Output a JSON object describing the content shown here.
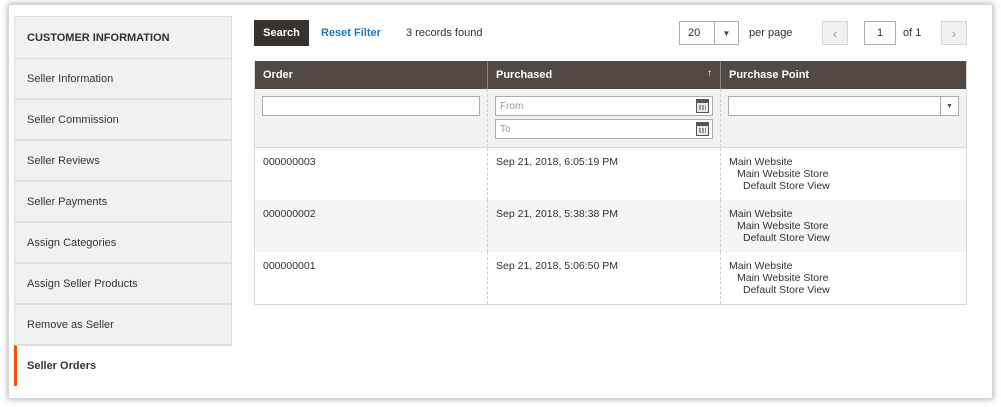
{
  "sidebar": {
    "title": "CUSTOMER INFORMATION",
    "items": [
      {
        "label": "Seller Information"
      },
      {
        "label": "Seller Commission"
      },
      {
        "label": "Seller Reviews"
      },
      {
        "label": "Seller Payments"
      },
      {
        "label": "Assign Categories"
      },
      {
        "label": "Assign Seller Products"
      },
      {
        "label": "Remove as Seller"
      },
      {
        "label": "Seller Orders"
      }
    ],
    "active_item": "Seller Orders"
  },
  "toolbar": {
    "search_label": "Search",
    "reset_label": "Reset Filter",
    "records_text": "3 records found",
    "per_page_value": "20",
    "per_page_label": "per page",
    "prev_icon": "chevron-left-icon",
    "next_icon": "chevron-right-icon",
    "current_page": "1",
    "of_pages": "of 1"
  },
  "grid": {
    "columns": [
      {
        "label": "Order"
      },
      {
        "label": "Purchased",
        "sort": "↑"
      },
      {
        "label": "Purchase Point"
      }
    ],
    "filters": {
      "order_value": "",
      "date_from_placeholder": "From",
      "date_to_placeholder": "To",
      "purchase_point_value": ""
    },
    "rows": [
      {
        "order": "000000003",
        "purchased": "Sep 21, 2018, 6:05:19 PM",
        "point": [
          "Main Website",
          "Main Website Store",
          "Default Store View"
        ]
      },
      {
        "order": "000000002",
        "purchased": "Sep 21, 2018, 5:38:38 PM",
        "point": [
          "Main Website",
          "Main Website Store",
          "Default Store View"
        ]
      },
      {
        "order": "000000001",
        "purchased": "Sep 21, 2018, 5:06:50 PM",
        "point": [
          "Main Website",
          "Main Website Store",
          "Default Store View"
        ]
      }
    ]
  },
  "colors": {
    "accent": "#eb5202",
    "link": "#1979c3",
    "header_bg": "#514943",
    "button_dark": "#373330"
  }
}
